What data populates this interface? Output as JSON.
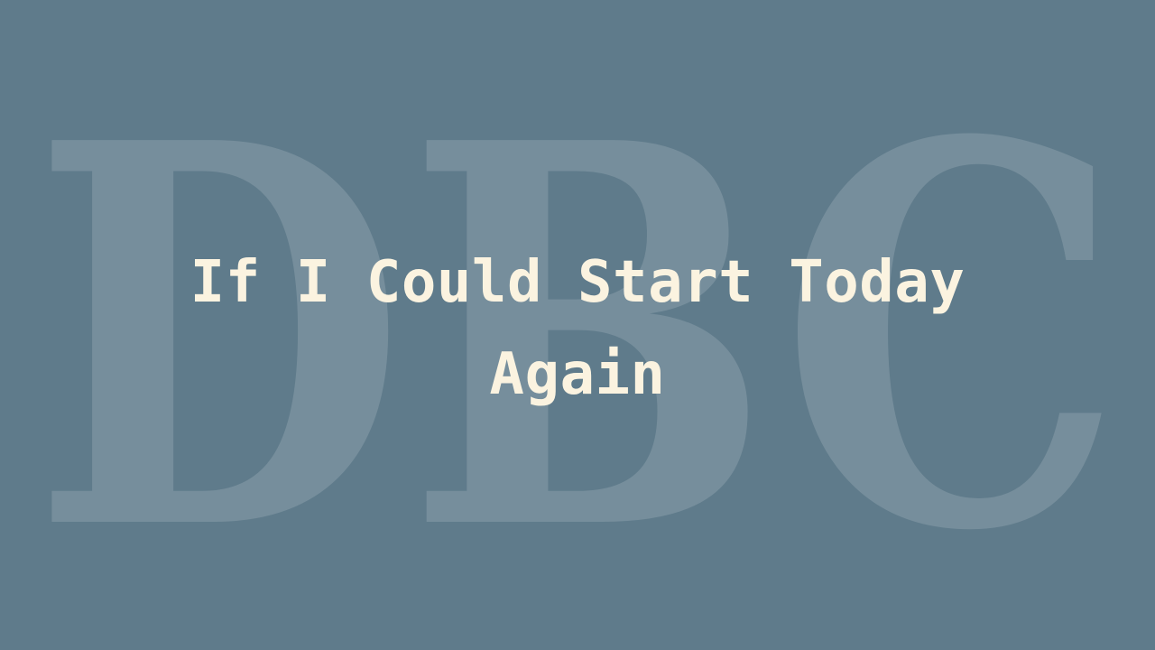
{
  "watermark": {
    "text": "DBC"
  },
  "title": {
    "line1": "If I Could Start Today",
    "line2": "Again"
  },
  "colors": {
    "background": "#5f7b8b",
    "title": "#fbf3e0",
    "watermark": "#ffffff"
  }
}
